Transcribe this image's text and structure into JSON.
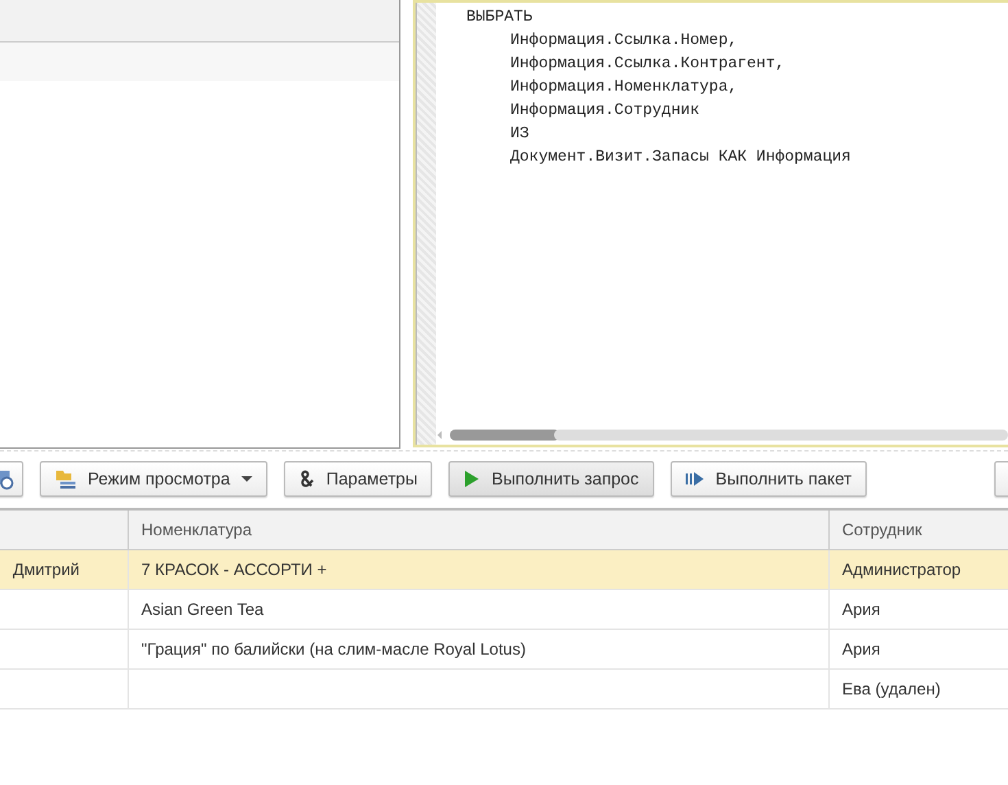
{
  "query_editor": {
    "lines": [
      {
        "text": "ВЫБРАТЬ",
        "children": [
          {
            "text": "Информация.Ссылка.Номер,"
          },
          {
            "text": "Информация.Ссылка.Контрагент,"
          },
          {
            "text": "Информация.Номенклатура,"
          },
          {
            "text": "Информация.Сотрудник"
          },
          {
            "text": "ИЗ"
          },
          {
            "text": "Документ.Визит.Запасы КАК Информация"
          }
        ]
      }
    ]
  },
  "toolbar": [
    {
      "kind": "icon"
    },
    {
      "kind": "dropdown",
      "label": "Режим просмотра",
      "default": false
    },
    {
      "kind": "params",
      "label": "Параметры",
      "default": false
    },
    {
      "kind": "run",
      "label": "Выполнить запрос",
      "default": true
    },
    {
      "kind": "batch",
      "label": "Выполнить пакет",
      "default": false
    }
  ],
  "table": {
    "columns": [
      "Номенклатура",
      "Сотрудник"
    ],
    "rows": [
      {
        "selected": true,
        "column_1": "Дмитрий",
        "nomenclature": "7 КРАСОК - АССОРТИ +",
        "employee": "Администратор"
      },
      {
        "selected": false,
        "nomenclature": "Asian Green Tea",
        "employee": "Ария"
      },
      {
        "selected": false,
        "nomenclature": "\"Грация\" по балийски (на слим-масле Royal Lotus)",
        "employee": "Ария"
      },
      {
        "selected": false,
        "employee": "Ева (удален)"
      }
    ]
  }
}
